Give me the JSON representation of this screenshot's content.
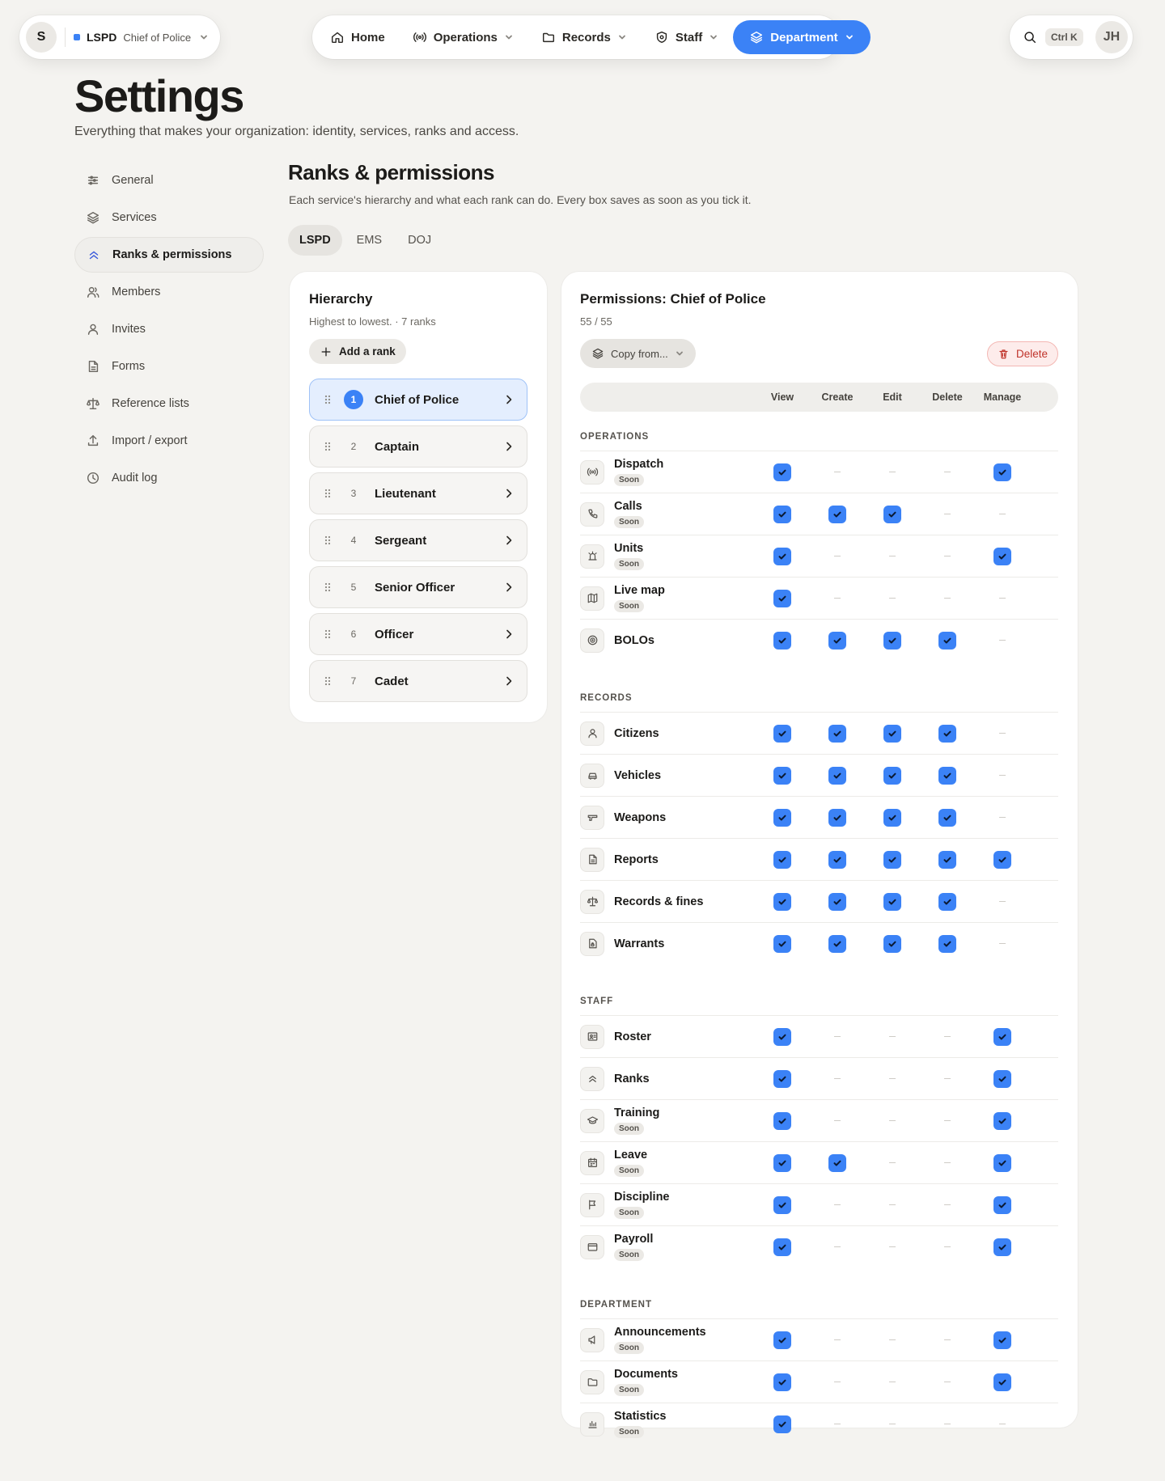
{
  "org": {
    "avatar": "S",
    "code": "LSPD",
    "role": "Chief of Police"
  },
  "nav": [
    {
      "label": "Home",
      "icon": "home-icon",
      "dropdown": false,
      "active": false
    },
    {
      "label": "Operations",
      "icon": "broadcast-icon",
      "dropdown": true,
      "active": false
    },
    {
      "label": "Records",
      "icon": "folder-icon",
      "dropdown": true,
      "active": false
    },
    {
      "label": "Staff",
      "icon": "shield-icon",
      "dropdown": true,
      "active": false
    },
    {
      "label": "Department",
      "icon": "layers-icon",
      "dropdown": true,
      "active": true
    }
  ],
  "search": {
    "shortcut": "Ctrl K"
  },
  "user": {
    "initials": "JH"
  },
  "header": {
    "title": "Settings",
    "subtitle": "Everything that makes your organization: identity, services, ranks and access."
  },
  "sidebar": [
    {
      "label": "General",
      "icon": "sliders-icon",
      "active": false
    },
    {
      "label": "Services",
      "icon": "layers-icon",
      "active": false
    },
    {
      "label": "Ranks & permissions",
      "icon": "chevrons-up-icon",
      "active": true
    },
    {
      "label": "Members",
      "icon": "users-icon",
      "active": false
    },
    {
      "label": "Invites",
      "icon": "user-icon",
      "active": false
    },
    {
      "label": "Forms",
      "icon": "file-icon",
      "active": false
    },
    {
      "label": "Reference lists",
      "icon": "scale-icon",
      "active": false
    },
    {
      "label": "Import / export",
      "icon": "upload-icon",
      "active": false
    },
    {
      "label": "Audit log",
      "icon": "clock-icon",
      "active": false
    }
  ],
  "section": {
    "title": "Ranks & permissions",
    "subtitle": "Each service's hierarchy and what each rank can do. Every box saves as soon as you tick it."
  },
  "service_tabs": [
    {
      "label": "LSPD",
      "active": true
    },
    {
      "label": "EMS",
      "active": false
    },
    {
      "label": "DOJ",
      "active": false
    }
  ],
  "hierarchy": {
    "title": "Hierarchy",
    "subtitle": "Highest to lowest. · 7 ranks",
    "add_label": "Add a rank",
    "ranks": [
      {
        "num": "1",
        "name": "Chief of Police",
        "active": true
      },
      {
        "num": "2",
        "name": "Captain",
        "active": false
      },
      {
        "num": "3",
        "name": "Lieutenant",
        "active": false
      },
      {
        "num": "4",
        "name": "Sergeant",
        "active": false
      },
      {
        "num": "5",
        "name": "Senior Officer",
        "active": false
      },
      {
        "num": "6",
        "name": "Officer",
        "active": false
      },
      {
        "num": "7",
        "name": "Cadet",
        "active": false
      }
    ]
  },
  "permissions": {
    "title": "Permissions: Chief of Police",
    "count": "55 / 55",
    "copy_label": "Copy from...",
    "delete_label": "Delete",
    "columns": [
      "View",
      "Create",
      "Edit",
      "Delete",
      "Manage"
    ],
    "soon_label": "Soon",
    "groups": [
      {
        "name": "OPERATIONS",
        "rows": [
          {
            "name": "Dispatch",
            "icon": "broadcast-icon",
            "soon": true,
            "cells": [
              1,
              0,
              0,
              0,
              1
            ]
          },
          {
            "name": "Calls",
            "icon": "phone-icon",
            "soon": true,
            "cells": [
              1,
              1,
              1,
              0,
              0
            ]
          },
          {
            "name": "Units",
            "icon": "siren-icon",
            "soon": true,
            "cells": [
              1,
              0,
              0,
              0,
              1
            ]
          },
          {
            "name": "Live map",
            "icon": "map-icon",
            "soon": true,
            "cells": [
              1,
              0,
              0,
              0,
              0
            ]
          },
          {
            "name": "BOLOs",
            "icon": "target-icon",
            "soon": false,
            "cells": [
              1,
              1,
              1,
              1,
              0
            ]
          }
        ]
      },
      {
        "name": "RECORDS",
        "rows": [
          {
            "name": "Citizens",
            "icon": "user-icon",
            "soon": false,
            "cells": [
              1,
              1,
              1,
              1,
              0
            ]
          },
          {
            "name": "Vehicles",
            "icon": "car-icon",
            "soon": false,
            "cells": [
              1,
              1,
              1,
              1,
              0
            ]
          },
          {
            "name": "Weapons",
            "icon": "gun-icon",
            "soon": false,
            "cells": [
              1,
              1,
              1,
              1,
              0
            ]
          },
          {
            "name": "Reports",
            "icon": "file-icon",
            "soon": false,
            "cells": [
              1,
              1,
              1,
              1,
              1
            ]
          },
          {
            "name": "Records & fines",
            "icon": "scale-icon",
            "soon": false,
            "cells": [
              1,
              1,
              1,
              1,
              0
            ]
          },
          {
            "name": "Warrants",
            "icon": "file-lock-icon",
            "soon": false,
            "cells": [
              1,
              1,
              1,
              1,
              0
            ]
          }
        ]
      },
      {
        "name": "STAFF",
        "rows": [
          {
            "name": "Roster",
            "icon": "id-card-icon",
            "soon": false,
            "cells": [
              1,
              0,
              0,
              0,
              1
            ]
          },
          {
            "name": "Ranks",
            "icon": "chevrons-up-icon",
            "soon": false,
            "cells": [
              1,
              0,
              0,
              0,
              1
            ]
          },
          {
            "name": "Training",
            "icon": "graduation-cap-icon",
            "soon": true,
            "cells": [
              1,
              0,
              0,
              0,
              1
            ]
          },
          {
            "name": "Leave",
            "icon": "calendar-icon",
            "soon": true,
            "cells": [
              1,
              1,
              0,
              0,
              1
            ]
          },
          {
            "name": "Discipline",
            "icon": "flag-icon",
            "soon": true,
            "cells": [
              1,
              0,
              0,
              0,
              1
            ]
          },
          {
            "name": "Payroll",
            "icon": "wallet-icon",
            "soon": true,
            "cells": [
              1,
              0,
              0,
              0,
              1
            ]
          }
        ]
      },
      {
        "name": "DEPARTMENT",
        "rows": [
          {
            "name": "Announcements",
            "icon": "megaphone-icon",
            "soon": true,
            "cells": [
              1,
              0,
              0,
              0,
              1
            ]
          },
          {
            "name": "Documents",
            "icon": "folder-icon",
            "soon": true,
            "cells": [
              1,
              0,
              0,
              0,
              1
            ]
          },
          {
            "name": "Statistics",
            "icon": "bar-chart-icon",
            "soon": true,
            "cells": [
              1,
              0,
              0,
              0,
              0
            ]
          }
        ]
      }
    ]
  }
}
